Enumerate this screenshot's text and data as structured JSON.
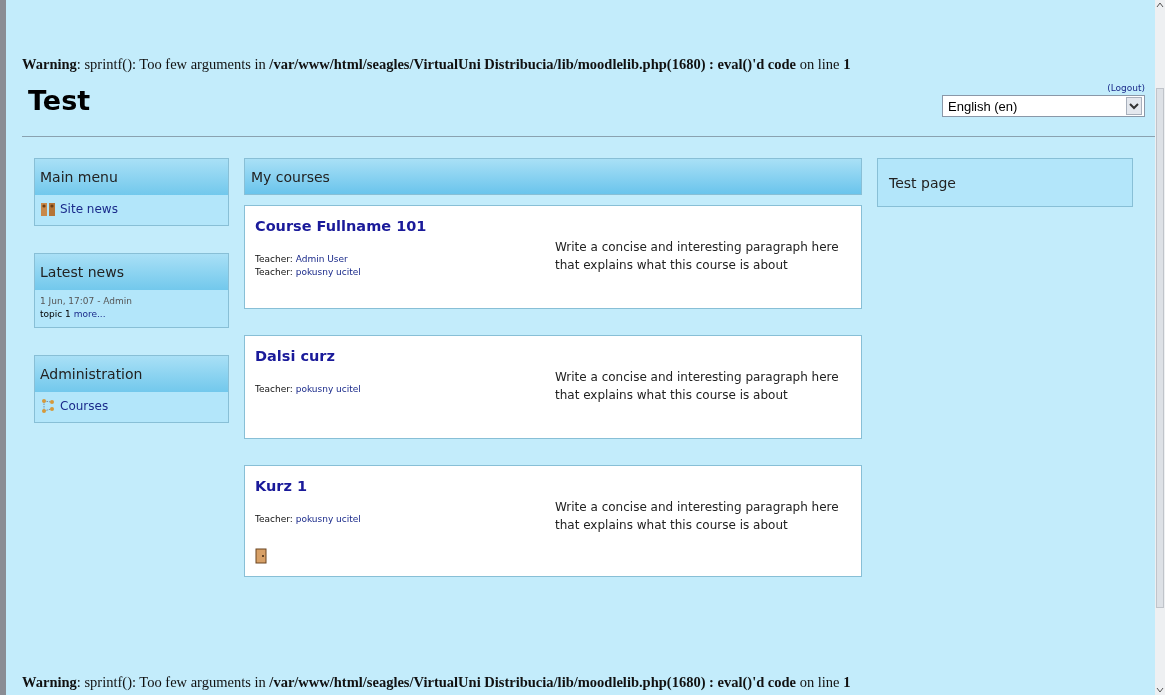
{
  "warnings": [
    "**Warning**: sprintf(): Too few arguments in **/var/www/html/seagles/VirtualUni Distribucia/lib/moodlelib.php(1680) : eval()'d code** on line **1**",
    "**Warning**: sprintf(): Too few arguments in **/var/www/html/seagles/VirtualUni Distribucia/lib/moodlelib.php(1680) : eval()'d code** on line **1**"
  ],
  "header": {
    "site_title": "Test",
    "logout": "(Logout)",
    "language": {
      "value": "English (en)"
    }
  },
  "left_blocks": [
    {
      "title": "Main menu",
      "kind": "menu",
      "items": [
        {
          "label": "Site news",
          "kind": "news"
        }
      ]
    },
    {
      "title": "Latest news",
      "kind": "news",
      "meta": "1 Jun, 17:07 - Admin",
      "topic": "topic 1",
      "more": "more..."
    },
    {
      "title": "Administration",
      "kind": "menu",
      "items": [
        {
          "label": "Courses",
          "kind": "courses"
        }
      ]
    }
  ],
  "main": {
    "title": "My courses",
    "courses": [
      {
        "name": "Course Fullname 101",
        "teachers": [
          {
            "label": "Teacher:",
            "name": "Admin User"
          },
          {
            "label": "Teacher:",
            "name": "pokusny ucitel"
          }
        ],
        "summary": "Write a concise and interesting paragraph here that explains what this course is about",
        "enrol_icon": false
      },
      {
        "name": "Dalsi curz",
        "teachers": [
          {
            "label": "Teacher:",
            "name": "pokusny ucitel"
          }
        ],
        "summary": "Write a concise and interesting paragraph here that explains what this course is about",
        "enrol_icon": false
      },
      {
        "name": "Kurz 1",
        "teachers": [
          {
            "label": "Teacher:",
            "name": "pokusny ucitel"
          }
        ],
        "summary": "Write a concise and interesting paragraph here that explains what this course is about",
        "enrol_icon": true
      }
    ]
  },
  "right_blocks": [
    {
      "title": "Test page"
    }
  ]
}
